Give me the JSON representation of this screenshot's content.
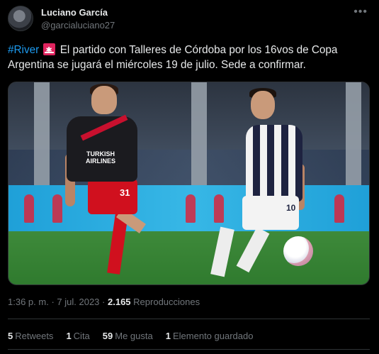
{
  "author": {
    "name": "Luciano García",
    "handle": "@garcialuciano27"
  },
  "more_icon": "more-dots-icon",
  "tweet": {
    "hashtag": "#River",
    "emoji": "river-plate-flag",
    "text": "El partido con Talleres de Córdoba por los 16vos de Copa Argentina se jugará el miércoles 19 de julio. Sede a confirmar."
  },
  "media": {
    "sponsor_line1": "TURKISH",
    "sponsor_line2": "AIRLINES",
    "player1_number": "31",
    "player2_number": "10"
  },
  "meta": {
    "time": "1:36 p. m.",
    "separator": "·",
    "date": "7 jul. 2023",
    "views_count": "2.165",
    "views_label": "Reproducciones"
  },
  "stats": [
    {
      "count": "5",
      "label": "Retweets"
    },
    {
      "count": "1",
      "label": "Cita"
    },
    {
      "count": "59",
      "label": "Me gusta"
    },
    {
      "count": "1",
      "label": "Elemento guardado"
    }
  ],
  "colors": {
    "background": "#000000",
    "text": "#e7e9ea",
    "muted": "#71767b",
    "link": "#1d9bf0",
    "border": "#2f3336"
  }
}
